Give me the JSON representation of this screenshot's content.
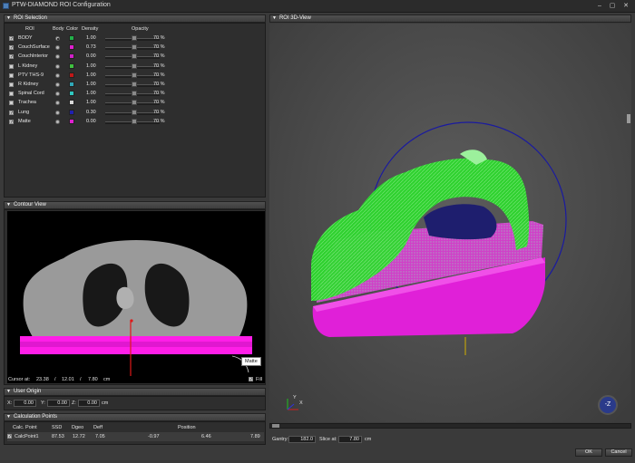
{
  "window": {
    "title": "PTW-DIAMOND ROI Configuration",
    "min": "–",
    "max": "▢",
    "close": "✕"
  },
  "roi_panel": {
    "title": "ROI Selection",
    "columns": {
      "roi": "ROI",
      "body": "Body",
      "color": "Color",
      "density": "Density",
      "opacity": "Opacity"
    },
    "rows": [
      {
        "checked": true,
        "name": "BODY",
        "body": true,
        "color": "#22b04a",
        "density": "1.00",
        "opacity": "70 %"
      },
      {
        "checked": true,
        "name": "CouchSurface",
        "body": false,
        "color": "#e020d0",
        "density": "0.73",
        "opacity": "70 %"
      },
      {
        "checked": true,
        "name": "CouchInterior",
        "body": false,
        "color": "#d020c8",
        "density": "0.00",
        "opacity": "70 %"
      },
      {
        "checked": false,
        "name": "L Kidney",
        "body": false,
        "color": "#40c040",
        "density": "1.00",
        "opacity": "70 %"
      },
      {
        "checked": false,
        "name": "PTV THS-9",
        "body": false,
        "color": "#c01818",
        "density": "1.00",
        "opacity": "70 %"
      },
      {
        "checked": false,
        "name": "R Kidney",
        "body": false,
        "color": "#30a8b8",
        "density": "1.00",
        "opacity": "70 %"
      },
      {
        "checked": false,
        "name": "Spinal Cord",
        "body": false,
        "color": "#30c8c0",
        "density": "1.00",
        "opacity": "70 %"
      },
      {
        "checked": false,
        "name": "Trachea",
        "body": false,
        "color": "#d8d8d8",
        "density": "1.00",
        "opacity": "70 %"
      },
      {
        "checked": true,
        "name": "Lung",
        "body": false,
        "color": "#2020b0",
        "density": "0.30",
        "opacity": "70 %"
      },
      {
        "checked": true,
        "name": "Matte",
        "body": false,
        "color": "#e020d0",
        "density": "0.00",
        "opacity": "70 %"
      }
    ]
  },
  "contour_view": {
    "title": "Contour View",
    "cursor_label": "Cursor at:",
    "cursor_x": "23.38",
    "sep1": "/",
    "cursor_y": "12.01",
    "sep2": "/",
    "cursor_z": "7.80",
    "unit": "cm",
    "tooltip": "Matte",
    "fill_label": "Fill"
  },
  "user_origin": {
    "title": "User Origin",
    "x_label": "X:",
    "x": "0.00",
    "y_label": "Y:",
    "y": "0.00",
    "z_label": "Z:",
    "z": "0.00",
    "unit": "cm"
  },
  "calc_points": {
    "title": "Calculation Points",
    "headers": {
      "name": "Calc. Point",
      "ssd": "SSD",
      "dgeo": "Dgeo",
      "deff": "Deff",
      "position": "Position"
    },
    "rows": [
      {
        "name": "CalcPoint1",
        "ssd": "87.53",
        "dgeo": "12.72",
        "deff": "7.05",
        "px": "-0.97",
        "py": "6.46",
        "pz": "7.89"
      }
    ]
  },
  "roi_3d": {
    "title": "ROI 3D-View",
    "gantry_label": "Gantry:",
    "gantry": "182.0",
    "slice_label": "Slice at:",
    "slice": "7.80",
    "unit": "cm",
    "gizmo": "-Z",
    "axis_x": "X",
    "axis_y": "Y"
  },
  "footer": {
    "ok": "OK",
    "cancel": "Cancel"
  },
  "colors": {
    "green": "#22cc22",
    "magenta": "#e020d0",
    "lung": "#1a1a70"
  }
}
